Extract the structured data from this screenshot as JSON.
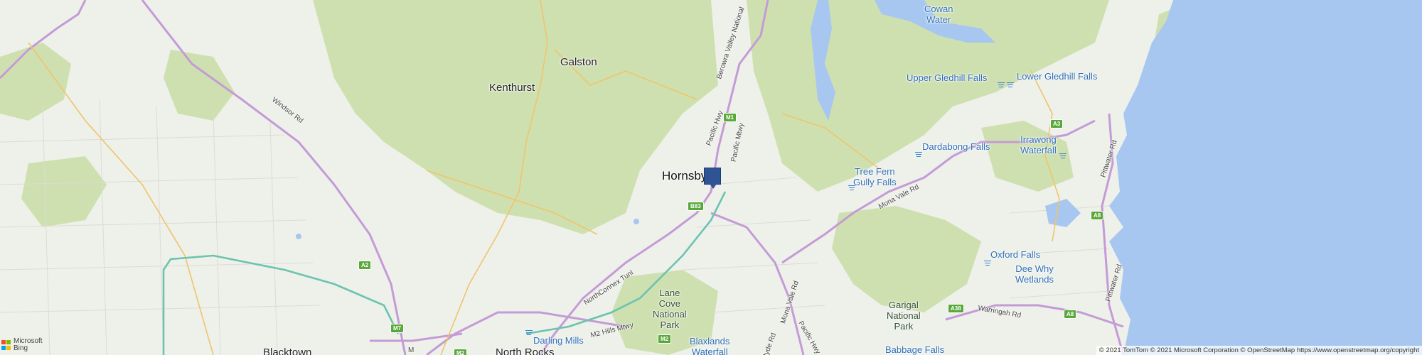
{
  "map": {
    "places": {
      "galston": "Galston",
      "kenthurst": "Kenthurst",
      "hornsby": "Hornsby",
      "blacktown": "Blacktown",
      "north_rocks": "North Rocks"
    },
    "water": {
      "cowan_water": "Cowan\nWater",
      "upper_gledhill": "Upper Gledhill Falls",
      "lower_gledhill": "Lower Gledhill Falls",
      "dardabong": "Dardabong Falls",
      "irrawong": "Irrawong\nWaterfall",
      "tree_fern": "Tree Fern\nGully Falls",
      "oxford": "Oxford Falls",
      "dee_why": "Dee Why\nWetlands",
      "darling_mills": "Darling Mills",
      "blaxlands": "Blaxlands\nWaterfall",
      "babbage": "Babbage Falls"
    },
    "parks": {
      "lane_cove": "Lane\nCove\nNational\nPark",
      "garigal": "Garigal\nNational\nPark"
    },
    "roads": {
      "windsor": "Windsor Rd",
      "pacific_hwy": "Pacific Hwy",
      "pacific_mtwy": "Pacific Mtwy",
      "berowra": "Berowra Valley National",
      "mona_vale_rd": "Mona Vale Rd",
      "mona_vale_rd2": "Mona Vale Rd",
      "northconnex": "NorthConnex Tunl",
      "m2": "M2 Hills Mtwy",
      "ryde": "Ryde Rd",
      "pacific_hwy2": "Pacific Hwy",
      "pittwater": "Pittwater Rd",
      "pittwater2": "Pittwater Rd",
      "warringah": "Warringah Rd",
      "m_partial": "M"
    },
    "shields": {
      "m1": "M1",
      "b83": "B83",
      "a3": "A3",
      "a8a": "A8",
      "a8b": "A8",
      "a2": "A2",
      "m7": "M7",
      "m2a": "M2",
      "m2b": "M2",
      "a38": "A38"
    },
    "colors": {
      "land": "#eef0ea",
      "forest": "#cfe0b0",
      "sea": "#a8c7f0",
      "motorway": "#c9a0d8",
      "pin": "#2f5496"
    }
  },
  "branding": {
    "bing_line1": "Microsoft",
    "bing_line2": "Bing",
    "attribution": "© 2021 TomTom © 2021 Microsoft Corporation © OpenStreetMap https://www.openstreetmap.org/copyright"
  }
}
